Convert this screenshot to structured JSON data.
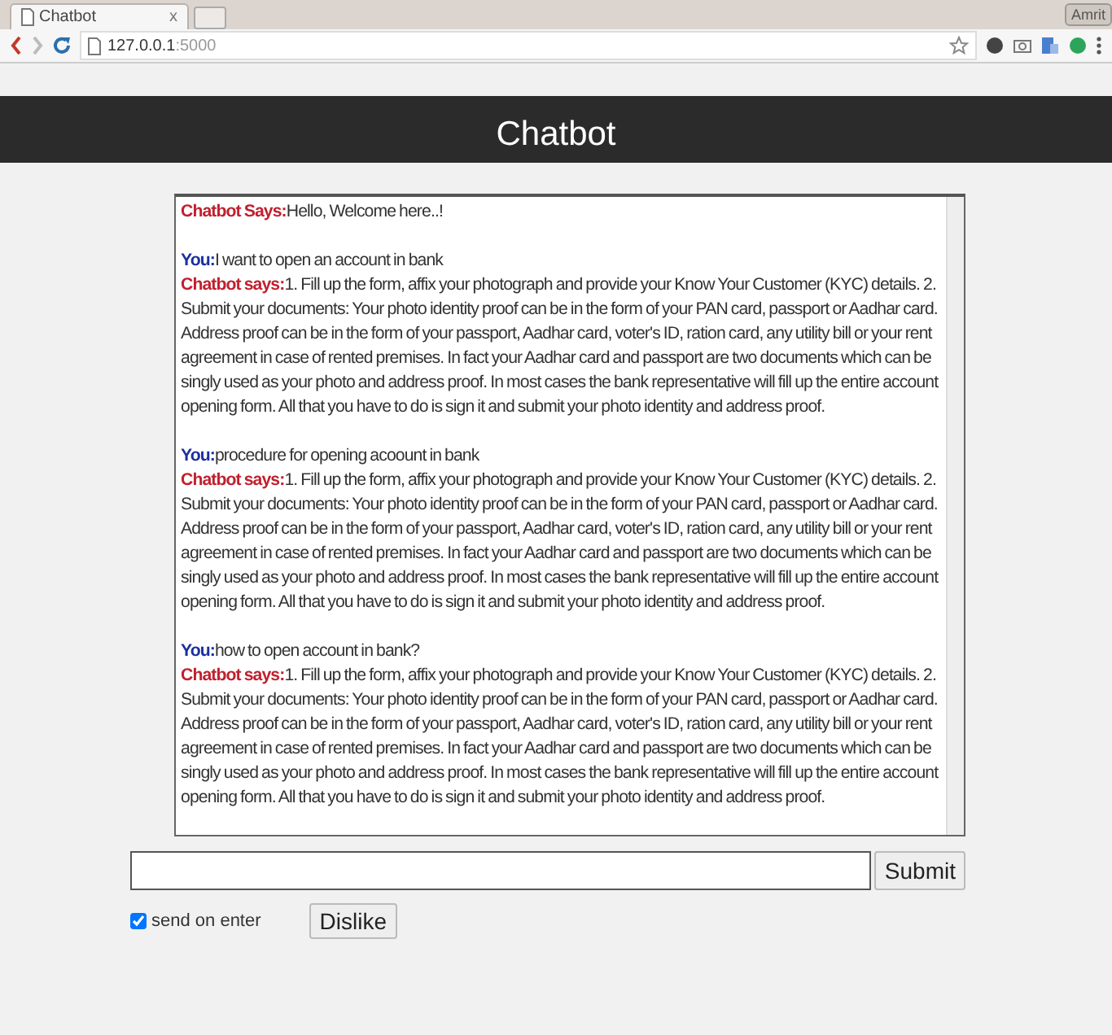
{
  "browser": {
    "tabs": [
      {
        "title": "Chatbot",
        "close": "x",
        "selected": true
      }
    ],
    "profile": "Amrit",
    "url_host": "127.0.0.1",
    "url_port": ":5000"
  },
  "header": {
    "title": "Chatbot"
  },
  "messages": [
    {
      "kind": "bot",
      "speaker": "Chatbot Says:",
      "text": "Hello, Welcome here..!"
    },
    {
      "kind": "user",
      "speaker": "You:",
      "text": "I want to open an account in bank"
    },
    {
      "kind": "bot",
      "speaker": "Chatbot says:",
      "text": "1. Fill up the form, affix your photograph and provide your Know Your Customer (KYC) details. 2. Submit your documents: Your photo identity proof can be in the form of your PAN card, passport or Aadhar card. Address proof can be in the form of your passport, Aadhar card, voter's ID, ration card, any utility bill or your rent agreement in case of rented premises. In fact your Aadhar card and passport are two documents which can be singly used as your photo and address proof. In most cases the bank representative will fill up the entire account opening form. All that you have to do is sign it and submit your photo identity and address proof."
    },
    {
      "kind": "user",
      "speaker": "You:",
      "text": "procedure for opening acoount in bank"
    },
    {
      "kind": "bot",
      "speaker": "Chatbot says:",
      "text": "1. Fill up the form, affix your photograph and provide your Know Your Customer (KYC) details. 2. Submit your documents: Your photo identity proof can be in the form of your PAN card, passport or Aadhar card. Address proof can be in the form of your passport, Aadhar card, voter's ID, ration card, any utility bill or your rent agreement in case of rented premises. In fact your Aadhar card and passport are two documents which can be singly used as your photo and address proof. In most cases the bank representative will fill up the entire account opening form. All that you have to do is sign it and submit your photo identity and address proof."
    },
    {
      "kind": "user",
      "speaker": "You:",
      "text": "how to open account in bank?"
    },
    {
      "kind": "bot",
      "speaker": "Chatbot says:",
      "text": "1. Fill up the form, affix your photograph and provide your Know Your Customer (KYC) details. 2. Submit your documents: Your photo identity proof can be in the form of your PAN card, passport or Aadhar card. Address proof can be in the form of your passport, Aadhar card, voter's ID, ration card, any utility bill or your rent agreement in case of rented premises. In fact your Aadhar card and passport are two documents which can be singly used as your photo and address proof. In most cases the bank representative will fill up the entire account opening form. All that you have to do is sign it and submit your photo identity and address proof."
    }
  ],
  "submit_label": "Submit",
  "send_on_enter": {
    "label": "send on enter",
    "checked": true
  },
  "dislike_label": "Dislike"
}
